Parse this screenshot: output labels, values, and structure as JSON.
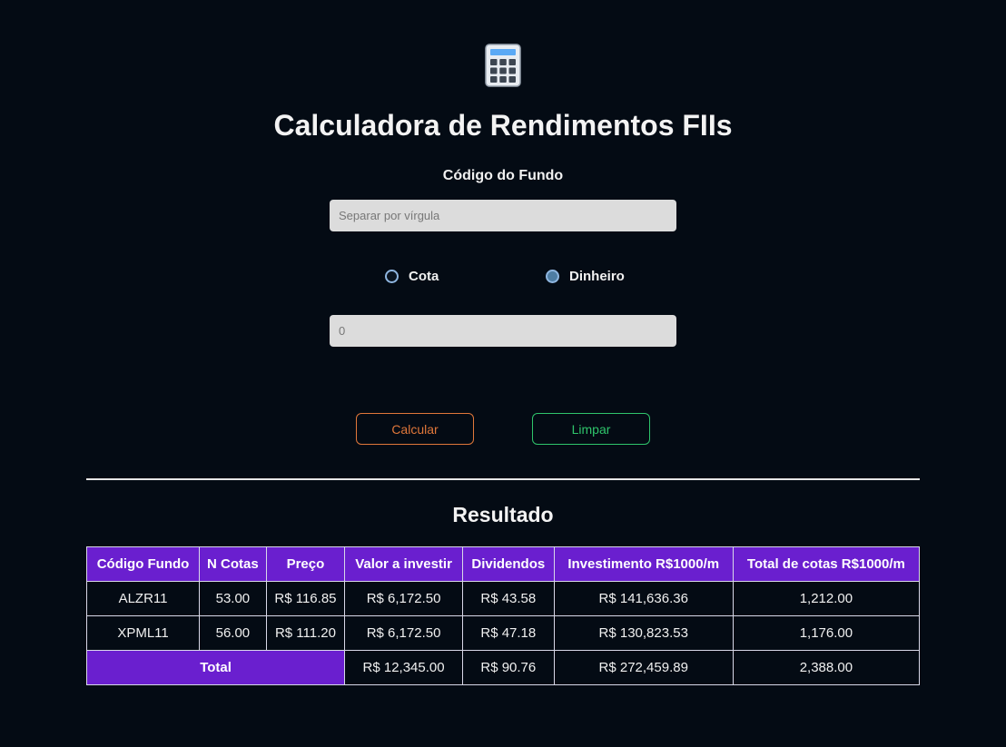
{
  "header": {
    "icon": "calculator-icon",
    "title": "Calculadora de Rendimentos FIIs"
  },
  "form": {
    "codigo_label": "Código do Fundo",
    "codigo_placeholder": "Separar por vírgula",
    "codigo_value": "",
    "mode_options": [
      {
        "label": "Cota",
        "selected": false
      },
      {
        "label": "Dinheiro",
        "selected": true
      }
    ],
    "valor_placeholder": "0",
    "valor_value": ""
  },
  "buttons": {
    "calcular": "Calcular",
    "limpar": "Limpar"
  },
  "result": {
    "title": "Resultado",
    "columns": [
      "Código Fundo",
      "N Cotas",
      "Preço",
      "Valor a investir",
      "Dividendos",
      "Investimento R$1000/m",
      "Total de cotas R$1000/m"
    ],
    "rows": [
      {
        "codigo": "ALZR11",
        "cotas": "53.00",
        "preco": "R$ 116.85",
        "valor": "R$ 6,172.50",
        "dividendos": "R$ 43.58",
        "investimento": "R$ 141,636.36",
        "total_cotas": "1,212.00"
      },
      {
        "codigo": "XPML11",
        "cotas": "56.00",
        "preco": "R$ 111.20",
        "valor": "R$ 6,172.50",
        "dividendos": "R$ 47.18",
        "investimento": "R$ 130,823.53",
        "total_cotas": "1,176.00"
      }
    ],
    "total": {
      "label": "Total",
      "valor": "R$ 12,345.00",
      "dividendos": "R$ 90.76",
      "investimento": "R$ 272,459.89",
      "total_cotas": "2,388.00"
    }
  },
  "colors": {
    "background": "#040b14",
    "table_header": "#6a1fcf",
    "calcular_accent": "#e0773a",
    "limpar_accent": "#2fc46b"
  }
}
